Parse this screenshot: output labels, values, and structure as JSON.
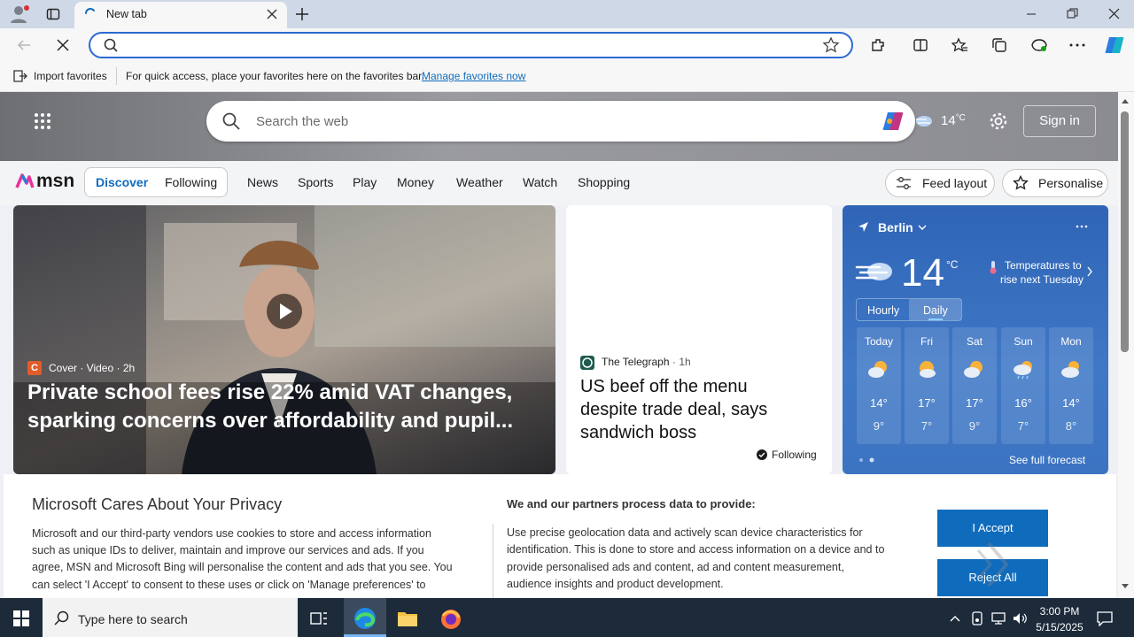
{
  "browser": {
    "tab_title": "New tab",
    "favbar": {
      "import_label": "Import favorites",
      "hint": "For quick access, place your favorites here on the favorites bar.",
      "manage_link": "Manage favorites now"
    }
  },
  "msn": {
    "search_placeholder": "Search the web",
    "weather_temp_small": "14",
    "weather_unit_small": "°C",
    "sign_in": "Sign in",
    "logo_text": "msn",
    "tabs": [
      "Discover",
      "Following"
    ],
    "nav": [
      "News",
      "Sports",
      "Play",
      "Money",
      "Weather",
      "Watch",
      "Shopping"
    ],
    "feed_layout": "Feed layout",
    "personalise": "Personalise",
    "accent": "#0f6cbd"
  },
  "cards": {
    "main": {
      "source_initial": "C",
      "source": "Cover · Video · 2h",
      "headline_line1": "Private school fees rise 22% amid VAT changes,",
      "headline_line2": "sparking concerns over affordability and pupil..."
    },
    "second": {
      "source": "The Telegraph",
      "time": "· 1h",
      "headline_line1": "US beef off the menu",
      "headline_line2": "despite trade deal, says",
      "headline_line3": "sandwich boss",
      "status": "Following"
    }
  },
  "weather": {
    "city": "Berlin",
    "temp": "14",
    "unit": "°C",
    "note_line1": "Temperatures to",
    "note_line2": "rise next Tuesday",
    "toggle": [
      "Hourly",
      "Daily"
    ],
    "days": [
      {
        "name": "Today",
        "high": "14°",
        "low": "9°",
        "icon": "partly-sunny-icon"
      },
      {
        "name": "Fri",
        "high": "17°",
        "low": "7°",
        "icon": "partly-sunny-icon"
      },
      {
        "name": "Sat",
        "high": "17°",
        "low": "9°",
        "icon": "partly-sunny-icon"
      },
      {
        "name": "Sun",
        "high": "16°",
        "low": "7°",
        "icon": "rain-cloud-icon"
      },
      {
        "name": "Mon",
        "high": "14°",
        "low": "8°",
        "icon": "partly-sunny-icon"
      }
    ],
    "see_forecast": "See full forecast"
  },
  "privacy": {
    "title": "Microsoft Cares About Your Privacy",
    "body_lines": [
      "Microsoft and our third-party vendors use cookies to store and access information",
      "such as unique IDs to deliver, maintain and improve our services and ads. If you",
      "agree, MSN and Microsoft Bing will personalise the content and ads that you see. You",
      "can select 'I Accept' to consent to these uses or click on 'Manage preferences' to"
    ],
    "partners_title": "We and our partners process data to provide:",
    "partners_lines": [
      "Use precise geolocation data and actively scan device characteristics for",
      "identification. This is done to store and access information on a device and to",
      "provide personalised ads and content, ad and content measurement,",
      "audience insights and product development."
    ],
    "accept": "I Accept",
    "reject": "Reject All",
    "button_color": "#0f6cbd"
  },
  "taskbar": {
    "search_placeholder": "Type here to search",
    "time": "3:00 PM",
    "date": "5/15/2025"
  }
}
